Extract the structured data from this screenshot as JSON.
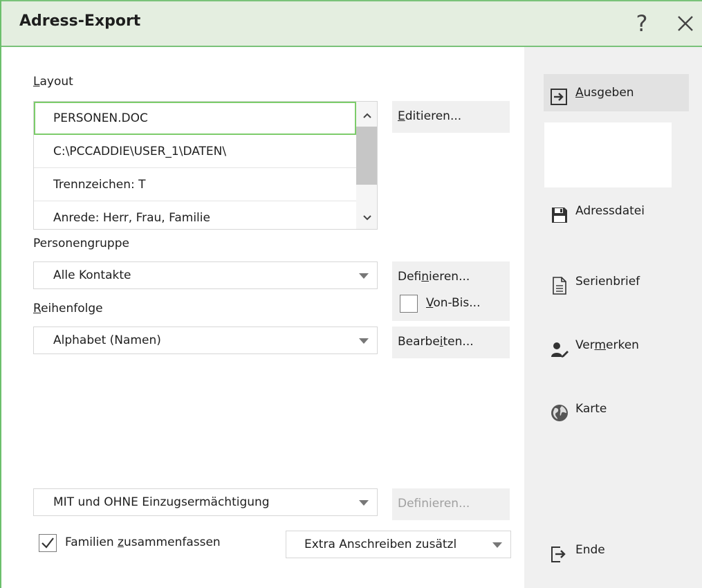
{
  "window": {
    "title": "Adress-Export"
  },
  "layout_section": {
    "label_first": "L",
    "label_rest": "ayout",
    "items": [
      "PERSONEN.DOC",
      "C:\\PCCADDIE\\USER_1\\DATEN\\",
      "Trennzeichen: T",
      "Anrede: Herr, Frau, Familie"
    ],
    "edit_first": "E",
    "edit_rest": "ditieren..."
  },
  "personengruppe": {
    "label": "Personengruppe",
    "value": "Alle Kontakte",
    "define_a": "Defi",
    "define_u": "n",
    "define_b": "ieren...",
    "vonbis_u": "V",
    "vonbis_rest": "on-Bis..."
  },
  "reihenfolge": {
    "label_first": "R",
    "label_rest": "eihenfolge",
    "value": "Alphabet (Namen)",
    "edit_a": "Bearbe",
    "edit_u": "i",
    "edit_b": "ten..."
  },
  "einzug": {
    "value": "MIT und OHNE Einzugsermächtigung",
    "define_label": "Definieren..."
  },
  "familien": {
    "label_a": "Familien ",
    "label_u": "z",
    "label_b": "usammenfassen",
    "checked": true,
    "extra_value": "Extra Anschreiben zusätzl"
  },
  "actions": {
    "ausgeben_u": "A",
    "ausgeben_rest": "usgeben",
    "adressdatei": "Adressdatei",
    "serienbrief": "Serienbrief",
    "vermerken_a": "Ver",
    "vermerken_u": "m",
    "vermerken_b": "erken",
    "karte": "Karte",
    "ende": "Ende"
  },
  "colors": {
    "accent_green": "#79c279",
    "title_bg": "#e4eee0",
    "panel_bg": "#f0f0f0"
  }
}
